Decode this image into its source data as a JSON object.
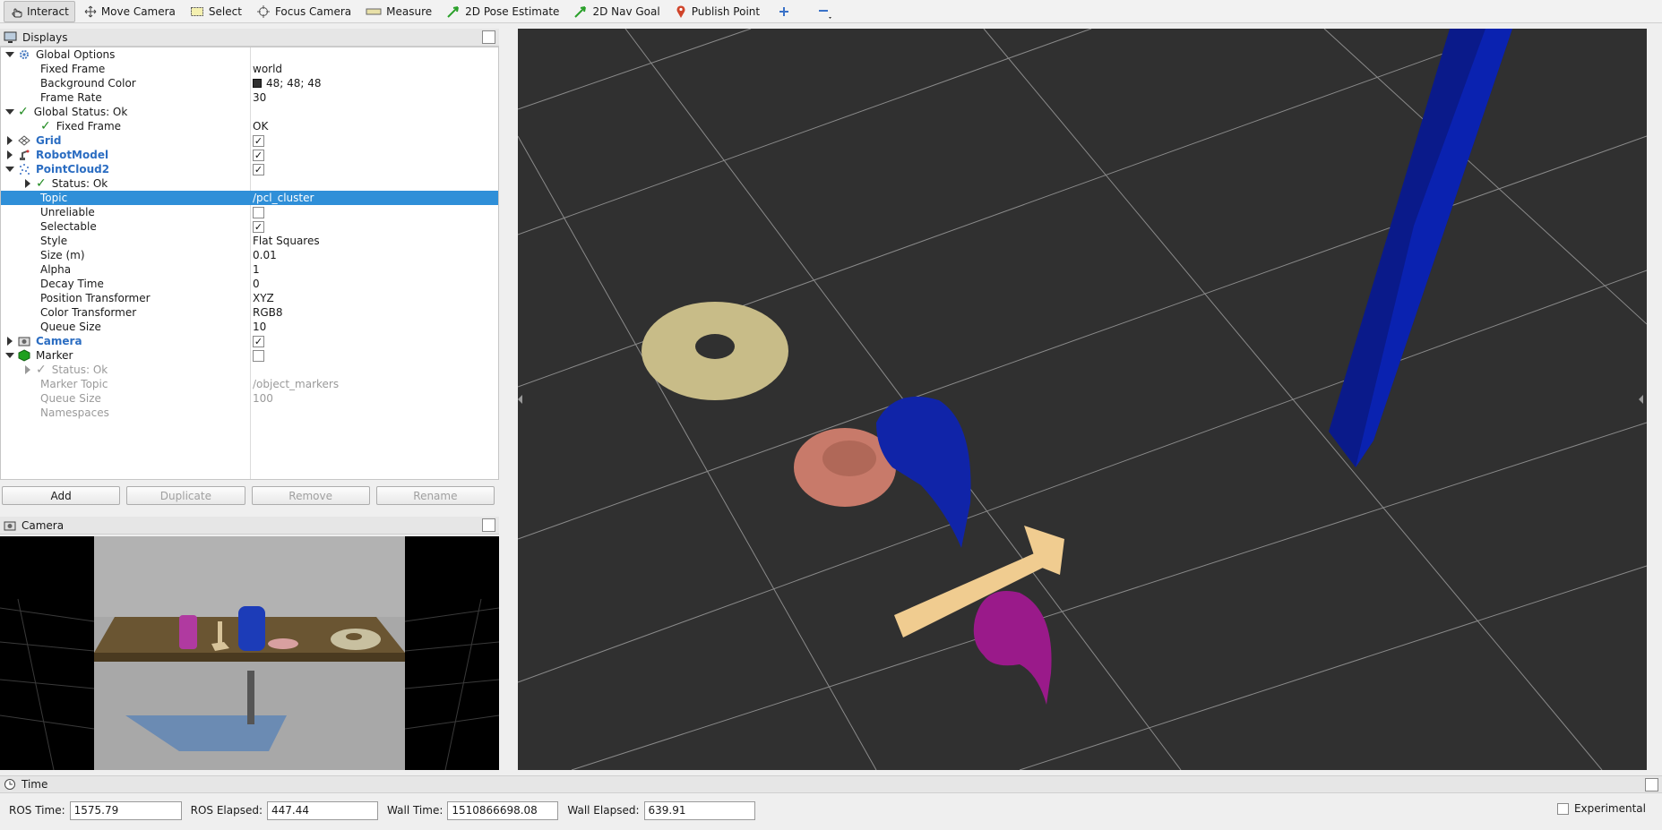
{
  "toolbar": {
    "interact": "Interact",
    "move_camera": "Move Camera",
    "select": "Select",
    "focus_camera": "Focus Camera",
    "measure": "Measure",
    "pose_estimate": "2D Pose Estimate",
    "nav_goal": "2D Nav Goal",
    "publish_point": "Publish Point"
  },
  "displays": {
    "title": "Displays",
    "rows": {
      "global_options": "Global Options",
      "fixed_frame": {
        "name": "Fixed Frame",
        "value": "world"
      },
      "background_color": {
        "name": "Background Color",
        "value": "48; 48; 48"
      },
      "frame_rate": {
        "name": "Frame Rate",
        "value": "30"
      },
      "global_status": "Global Status: Ok",
      "gs_fixed_frame": {
        "name": "Fixed Frame",
        "value": "OK"
      },
      "grid": "Grid",
      "robot_model": "RobotModel",
      "pointcloud2": "PointCloud2",
      "pc_status": "Status: Ok",
      "topic": {
        "name": "Topic",
        "value": "/pcl_cluster"
      },
      "unreliable": {
        "name": "Unreliable"
      },
      "selectable": {
        "name": "Selectable"
      },
      "style": {
        "name": "Style",
        "value": "Flat Squares"
      },
      "size": {
        "name": "Size (m)",
        "value": "0.01"
      },
      "alpha": {
        "name": "Alpha",
        "value": "1"
      },
      "decay_time": {
        "name": "Decay Time",
        "value": "0"
      },
      "position_transformer": {
        "name": "Position Transformer",
        "value": "XYZ"
      },
      "color_transformer": {
        "name": "Color Transformer",
        "value": "RGB8"
      },
      "queue_size": {
        "name": "Queue Size",
        "value": "10"
      },
      "camera": "Camera",
      "marker": "Marker",
      "marker_status": "Status: Ok",
      "marker_topic": {
        "name": "Marker Topic",
        "value": "/object_markers"
      },
      "marker_queue": {
        "name": "Queue Size",
        "value": "100"
      },
      "namespaces": {
        "name": "Namespaces"
      }
    },
    "checkbox_states": {
      "grid": true,
      "robot_model": true,
      "pointcloud2": true,
      "unreliable": false,
      "selectable": true,
      "camera": true,
      "marker": false
    }
  },
  "buttons": {
    "add": "Add",
    "duplicate": "Duplicate",
    "remove": "Remove",
    "rename": "Rename"
  },
  "camera_panel": {
    "title": "Camera"
  },
  "time": {
    "title": "Time",
    "ros_time_label": "ROS Time:",
    "ros_time": "1575.79",
    "ros_elapsed_label": "ROS Elapsed:",
    "ros_elapsed": "447.44",
    "wall_time_label": "Wall Time:",
    "wall_time": "1510866698.08",
    "wall_elapsed_label": "Wall Elapsed:",
    "wall_elapsed": "639.91",
    "experimental": "Experimental"
  },
  "colors": {
    "background": "#303030",
    "selection": "#2f8fd8",
    "display_name": "#2b6dc2"
  }
}
